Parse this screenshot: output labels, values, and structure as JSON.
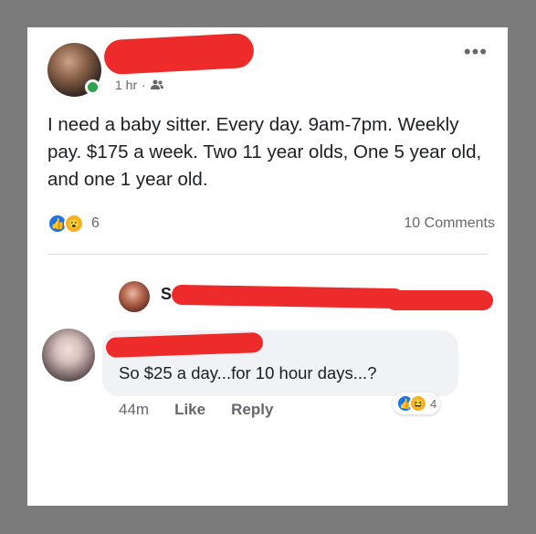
{
  "post": {
    "time": "1 hr",
    "separator": "·",
    "audience_icon": "friends-icon",
    "more_label": "•••",
    "text": "I need a baby sitter. Every day. 9am-7pm. Weekly pay. $175 a week. Two 11 year olds, One 5 year old, and one 1 year old.",
    "reaction_icons": [
      "like-icon",
      "wow-icon"
    ],
    "reaction_count": "6",
    "comments_count": "10 Comments"
  },
  "reply_preview": {
    "name_visible": "S"
  },
  "comment": {
    "text": "So $25 a day...for 10 hour days...?",
    "time": "44m",
    "like_label": "Like",
    "reply_label": "Reply",
    "reaction_icons": [
      "like-icon",
      "haha-icon"
    ],
    "reaction_count": "4"
  },
  "colors": {
    "background": "#7b7b7b",
    "card": "#ffffff",
    "redaction": "#ee2b2b",
    "like": "#1b74e4",
    "online": "#31a24c"
  }
}
